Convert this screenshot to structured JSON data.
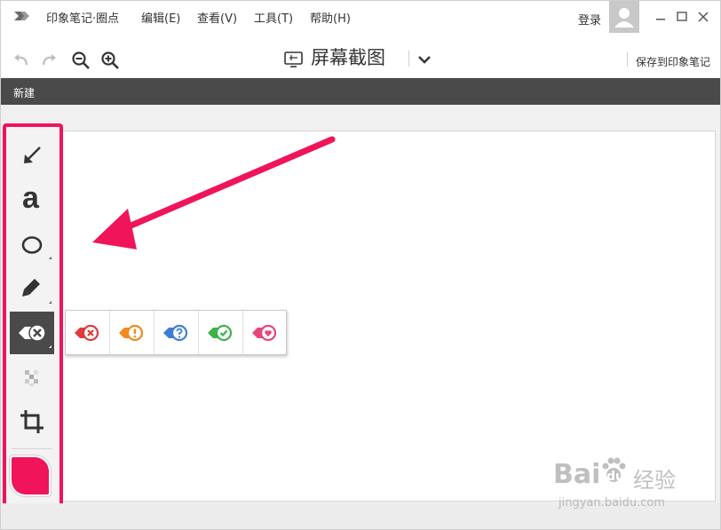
{
  "window": {
    "menu": [
      "印象笔记·圈点",
      "编辑(E)",
      "查看(V)",
      "工具(T)",
      "帮助(H)"
    ],
    "login": "登录"
  },
  "toolbar": {
    "title": "屏幕截图",
    "save_label": "保存到印象笔记"
  },
  "darkbar": {
    "label": "新建"
  },
  "tools": [
    {
      "name": "arrow-tool",
      "icon": "arrow-icon"
    },
    {
      "name": "text-tool",
      "icon": "text-a-icon",
      "glyph": "a"
    },
    {
      "name": "ellipse-tool",
      "icon": "ellipse-icon"
    },
    {
      "name": "marker-tool",
      "icon": "marker-icon"
    },
    {
      "name": "stamp-tool",
      "icon": "stamp-icon",
      "active": true
    },
    {
      "name": "pixelate-tool",
      "icon": "pixelate-icon"
    },
    {
      "name": "crop-tool",
      "icon": "crop-icon"
    }
  ],
  "stamps": [
    {
      "name": "reject",
      "color": "#e03a3a"
    },
    {
      "name": "warning",
      "color": "#f08a1c"
    },
    {
      "name": "question",
      "color": "#3a7fd5"
    },
    {
      "name": "approve",
      "color": "#3bb24a"
    },
    {
      "name": "love",
      "color": "#e8457a"
    }
  ],
  "colors": {
    "accent": "#f0145a",
    "darkbar": "#4a4a4a"
  },
  "watermark": {
    "brand": "Bai",
    "brand2": "du",
    "suffix": "经验",
    "url": "jingyan.baidu.com"
  }
}
